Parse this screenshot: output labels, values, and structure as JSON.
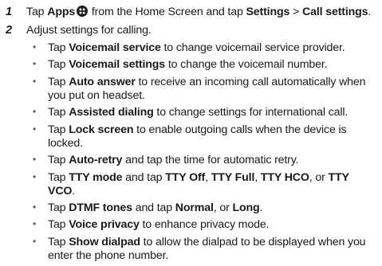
{
  "steps": [
    {
      "num": "1",
      "t1": "Tap ",
      "b1": "Apps",
      "icon": "apps-grid-icon",
      "t2": " from the Home Screen and tap ",
      "b2": "Settings",
      "t3": " > ",
      "b3": "Call settings",
      "t4": "."
    },
    {
      "num": "2",
      "text": "Adjust settings for calling."
    }
  ],
  "bullets": [
    {
      "a": "Tap ",
      "b": "Voicemail service",
      "c": " to change voicemail service provider."
    },
    {
      "a": "Tap ",
      "b": "Voicemail settings",
      "c": " to change the voicemail number."
    },
    {
      "a": "Tap ",
      "b": "Auto answer",
      "c": " to receive an incoming call automatically when you put on headset."
    },
    {
      "a": "Tap ",
      "b": "Assisted dialing",
      "c": " to change settings for international call."
    },
    {
      "a": "Tap ",
      "b": "Lock screen",
      "c": " to enable outgoing calls when the device is locked."
    },
    {
      "a": "Tap ",
      "b": "Auto-retry",
      "c": " and tap the time for automatic retry."
    },
    {
      "a": "Tap ",
      "b": "TTY mode",
      "c": " and tap ",
      "d": "TTY Off",
      "e": ", ",
      "f": "TTY Full",
      "g": ", ",
      "h": "TTY HCO",
      "i": ", or ",
      "j": "TTY VCO",
      "k": "."
    },
    {
      "a": "Tap ",
      "b": "DTMF tones",
      "c": " and tap ",
      "d": "Normal",
      "e": ", or ",
      "f": "Long",
      "g": "."
    },
    {
      "a": "Tap ",
      "b": "Voice privacy",
      "c": " to enhance privacy mode."
    },
    {
      "a": "Tap ",
      "b": "Show dialpad",
      "c": " to allow the dialpad to be displayed when you enter the phone number."
    }
  ],
  "bullet_glyph": "•",
  "colors": {
    "text": "#1a1a1a",
    "bullet": "#555555"
  }
}
